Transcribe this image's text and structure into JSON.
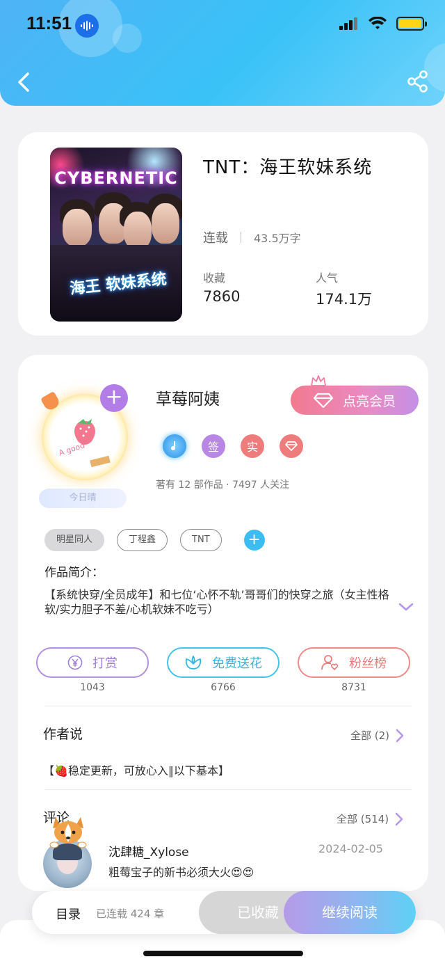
{
  "status_bar": {
    "time": "11:51"
  },
  "book": {
    "title": "TNT：海王软妹系统",
    "cover_title": "CYBERNETIC",
    "cover_sub": "海王 软妹系统",
    "status": "连载",
    "words": "43.5万字",
    "collect_label": "收藏",
    "collect_value": "7860",
    "popularity_label": "人气",
    "popularity_value": "174.1万"
  },
  "author": {
    "name": "草莓阿姨",
    "vip_button": "点亮会员",
    "today_badge": "今日晴",
    "badges": [
      "签",
      "实"
    ],
    "works_line": "著有 12 部作品 · 7497 人关注"
  },
  "tags": [
    "明星同人",
    "丁程鑫",
    "TNT"
  ],
  "intro": {
    "heading": "作品简介：",
    "text": "【系统快穿/全员成年】和七位‘心怀不轨’哥哥们的快穿之旅（女主性格软/实力胆子不差/心机软妹不吃亏）"
  },
  "actions": [
    {
      "label": "打赏",
      "count": "1043",
      "color": "#b28fe0"
    },
    {
      "label": "免费送花",
      "count": "6766",
      "color": "#42c3ea"
    },
    {
      "label": "粉丝榜",
      "count": "8731",
      "color": "#ee8a8a"
    }
  ],
  "author_say": {
    "title": "作者说",
    "more": "全部 (2)",
    "text": "【🍓稳定更新，可放心入‖以下基本】"
  },
  "comments": {
    "title": "评论",
    "more": "全部 (514)",
    "items": [
      {
        "user": "沈肆糖_Xylose",
        "date": "2024-02-05",
        "text": "粗莓宝子的新书必须大火😍😍"
      }
    ]
  },
  "bottom_bar": {
    "toc": "目录",
    "chapters": "已连载 424 章",
    "fav": "已收藏",
    "read": "继续阅读"
  }
}
